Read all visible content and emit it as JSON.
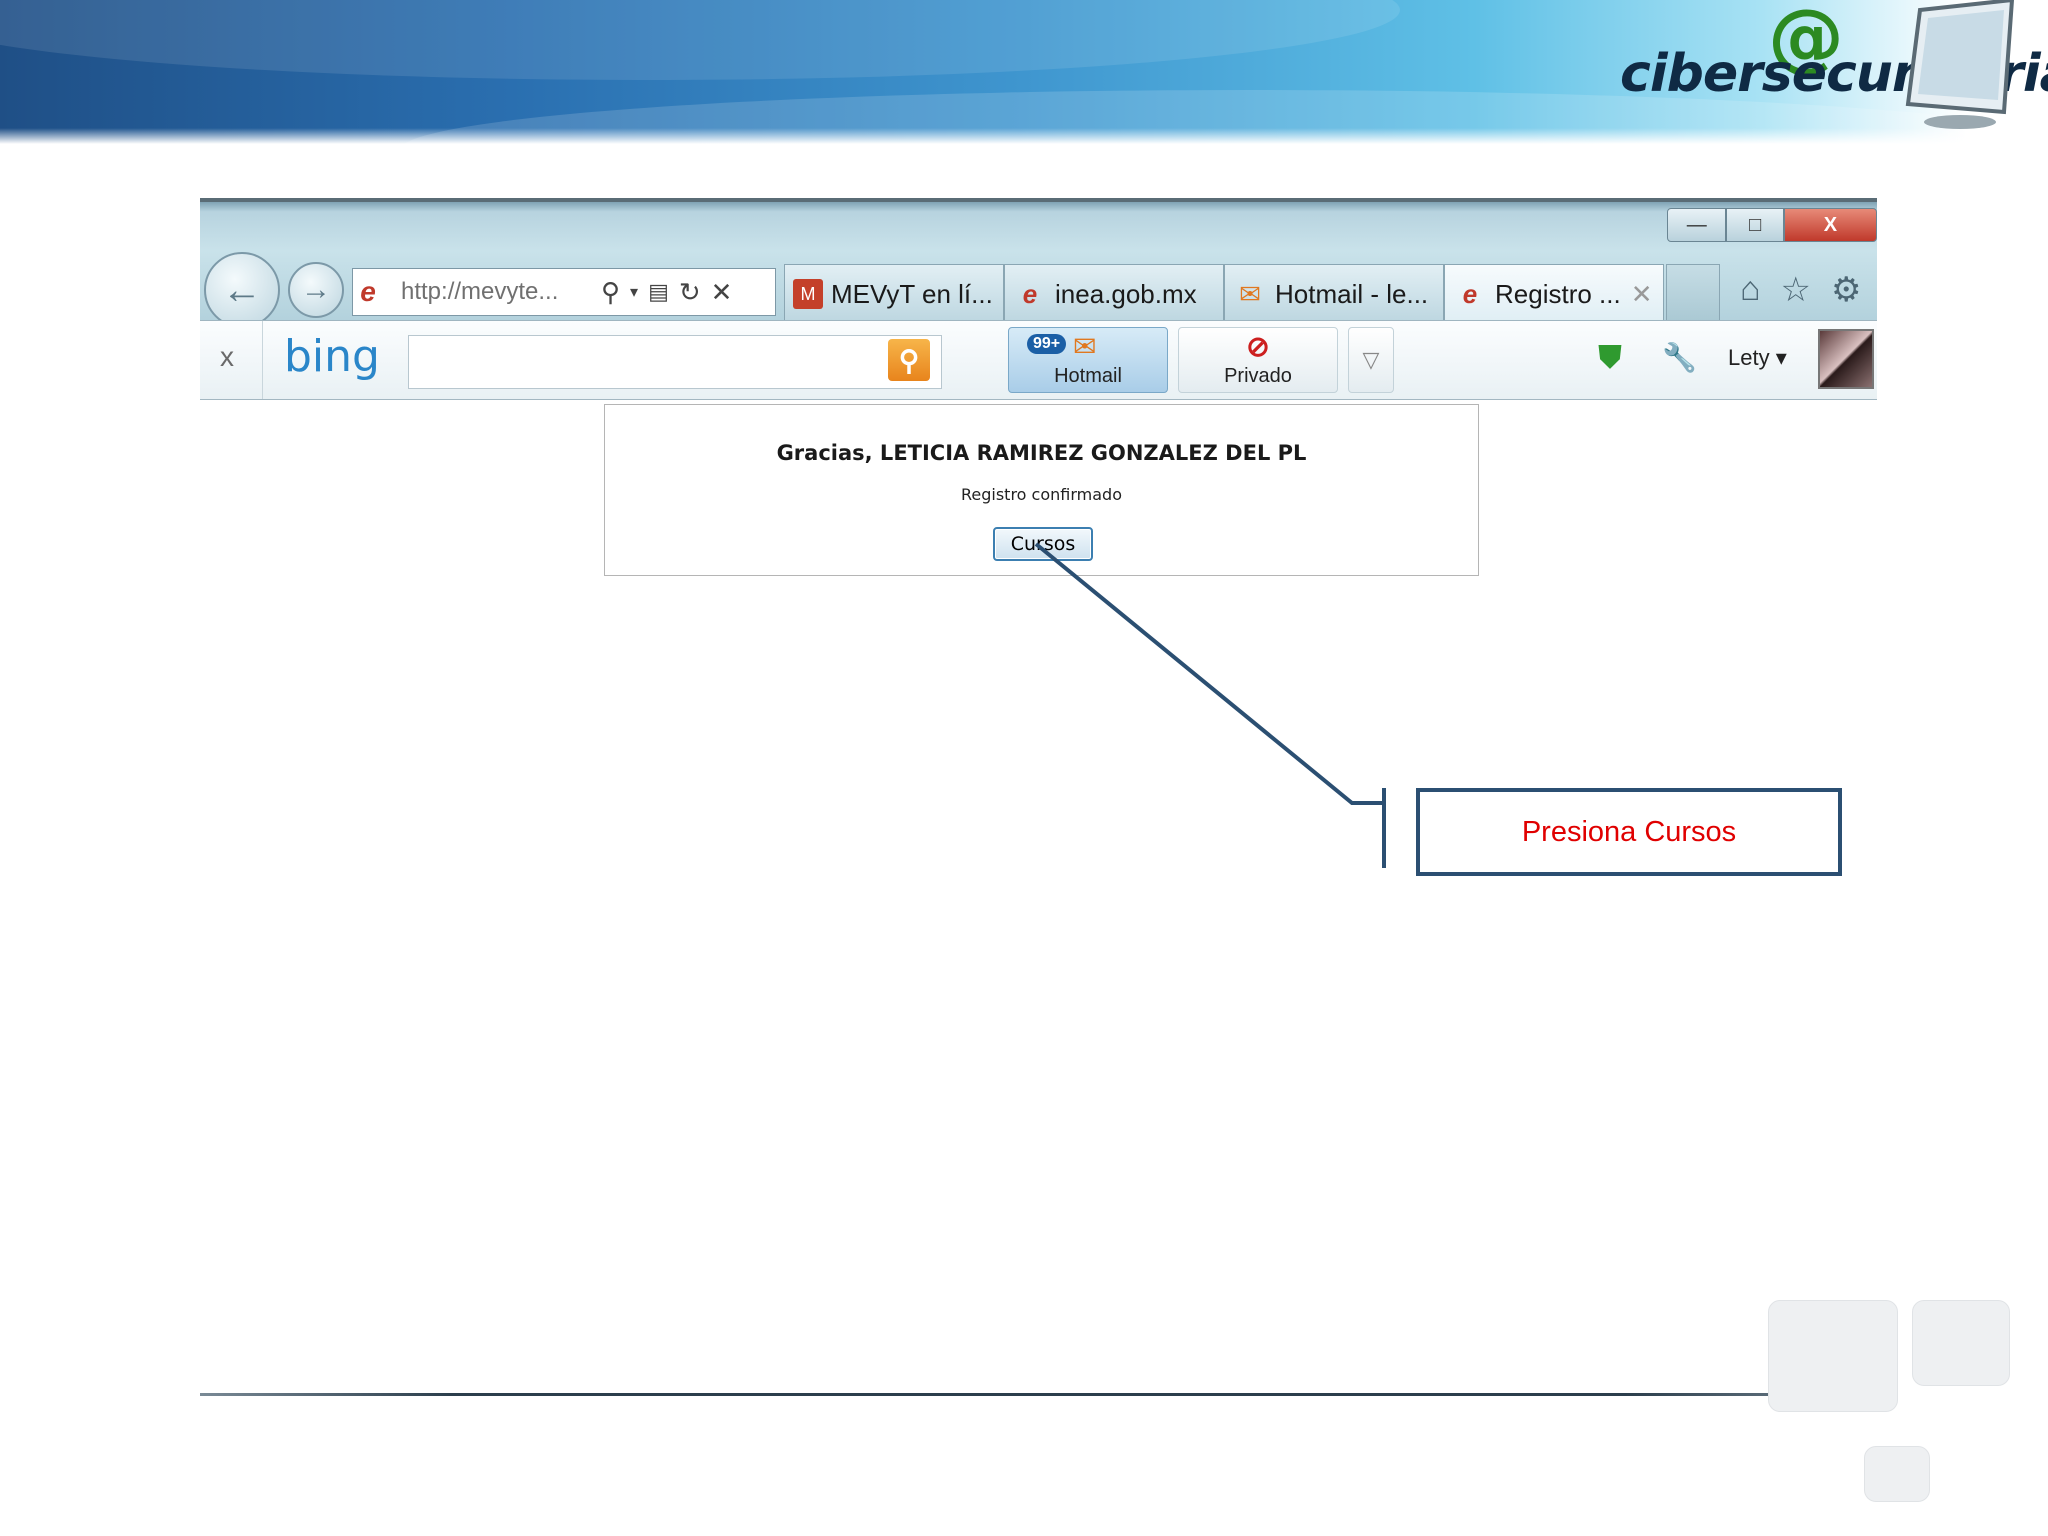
{
  "brand": {
    "logo_text": "cibersecundaria",
    "logo_symbol": "@"
  },
  "browser": {
    "address_url": "http://mevyte...",
    "tabs": [
      {
        "label": "MEVyT en lí...",
        "icon": "mevyt-icon"
      },
      {
        "label": "inea.gob.mx",
        "icon": "ie-icon"
      },
      {
        "label": "Hotmail - le...",
        "icon": "mail-icon"
      },
      {
        "label": "Registro ...",
        "icon": "ie-icon",
        "active": true
      }
    ],
    "window_controls": {
      "minimize": "—",
      "maximize": "□",
      "close": "X"
    },
    "toolbar": {
      "close_label": "x",
      "search_logo": "bing",
      "search_value": "",
      "hotmail_badge": "99+",
      "hotmail_label": "Hotmail",
      "privado_label": "Privado",
      "user_name": "Lety ▾"
    }
  },
  "page": {
    "title": "Gracias, LETICIA RAMIREZ GONZALEZ DEL PL",
    "subtitle": "Registro confirmado",
    "button_label": "Cursos"
  },
  "callout": {
    "text": "Presiona Cursos",
    "text_color": "#e00000",
    "border_color": "#2b4f72"
  }
}
